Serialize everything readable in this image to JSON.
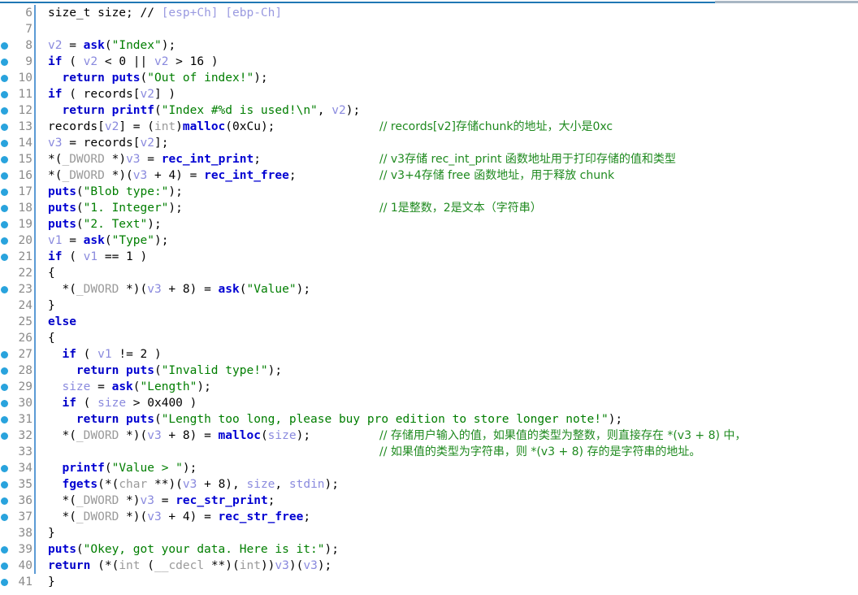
{
  "window": {
    "kind": "decompiler-pseudocode-view",
    "top_rule_color": "#1f77b4",
    "top_rule_secondary_color": "#a8b6c4"
  },
  "theme": {
    "background": "#ffffff",
    "keyword": "#0000c8",
    "function": "#0000d2",
    "string": "#007e00",
    "comment": "#1f8a1f",
    "variable": "#8a8ade",
    "type": "#9a9a9a",
    "linenumber": "#8b8b8b",
    "breakpoint_dot": "#29a3dd",
    "indent_bar": "#5b9bd5"
  },
  "code": {
    "first_line_number": 6,
    "last_line_number": 41,
    "lines": [
      {
        "n": "6",
        "dot": false,
        "bars": 1,
        "tokens": [
          {
            "t": "plain",
            "s": "size_t size; "
          },
          {
            "t": "plain",
            "s": "// "
          },
          {
            "t": "lavender",
            "s": "[esp+Ch] [ebp-Ch]"
          }
        ],
        "trailing": ""
      },
      {
        "n": "7",
        "dot": false,
        "bars": 1,
        "tokens": [],
        "trailing": ""
      },
      {
        "n": "8",
        "dot": true,
        "bars": 1,
        "tokens": [
          {
            "t": "var",
            "s": "v2"
          },
          {
            "t": "plain",
            "s": " = "
          },
          {
            "t": "fn",
            "s": "ask"
          },
          {
            "t": "plain",
            "s": "("
          },
          {
            "t": "str",
            "s": "\"Index\""
          },
          {
            "t": "plain",
            "s": ");"
          }
        ],
        "trailing": ""
      },
      {
        "n": "9",
        "dot": true,
        "bars": 1,
        "tokens": [
          {
            "t": "kw",
            "s": "if"
          },
          {
            "t": "plain",
            "s": " ( "
          },
          {
            "t": "var",
            "s": "v2"
          },
          {
            "t": "plain",
            "s": " < 0 || "
          },
          {
            "t": "var",
            "s": "v2"
          },
          {
            "t": "plain",
            "s": " > 16 )"
          }
        ],
        "trailing": ""
      },
      {
        "n": "10",
        "dot": true,
        "bars": 1,
        "tokens": [
          {
            "t": "plain",
            "s": "  "
          },
          {
            "t": "kw",
            "s": "return"
          },
          {
            "t": "plain",
            "s": " "
          },
          {
            "t": "fn",
            "s": "puts"
          },
          {
            "t": "plain",
            "s": "("
          },
          {
            "t": "str",
            "s": "\"Out of index!\""
          },
          {
            "t": "plain",
            "s": ");"
          }
        ],
        "trailing": ""
      },
      {
        "n": "11",
        "dot": true,
        "bars": 1,
        "tokens": [
          {
            "t": "kw",
            "s": "if"
          },
          {
            "t": "plain",
            "s": " ( records["
          },
          {
            "t": "var",
            "s": "v2"
          },
          {
            "t": "plain",
            "s": "] )"
          }
        ],
        "trailing": ""
      },
      {
        "n": "12",
        "dot": true,
        "bars": 1,
        "tokens": [
          {
            "t": "plain",
            "s": "  "
          },
          {
            "t": "kw",
            "s": "return"
          },
          {
            "t": "plain",
            "s": " "
          },
          {
            "t": "fn",
            "s": "printf"
          },
          {
            "t": "plain",
            "s": "("
          },
          {
            "t": "str",
            "s": "\"Index #%d is used!\\n\""
          },
          {
            "t": "plain",
            "s": ", "
          },
          {
            "t": "var",
            "s": "v2"
          },
          {
            "t": "plain",
            "s": ");"
          }
        ],
        "trailing": ""
      },
      {
        "n": "13",
        "dot": true,
        "bars": 1,
        "tokens": [
          {
            "t": "plain",
            "s": "records["
          },
          {
            "t": "var",
            "s": "v2"
          },
          {
            "t": "plain",
            "s": "] = ("
          },
          {
            "t": "typ",
            "s": "int"
          },
          {
            "t": "plain",
            "s": ")"
          },
          {
            "t": "fn",
            "s": "malloc"
          },
          {
            "t": "plain",
            "s": "(0xCu);"
          }
        ],
        "trailing": "// records[v2]存储chunk的地址，大小是0xc"
      },
      {
        "n": "14",
        "dot": true,
        "bars": 1,
        "tokens": [
          {
            "t": "var",
            "s": "v3"
          },
          {
            "t": "plain",
            "s": " = records["
          },
          {
            "t": "var",
            "s": "v2"
          },
          {
            "t": "plain",
            "s": "];"
          }
        ],
        "trailing": ""
      },
      {
        "n": "15",
        "dot": true,
        "bars": 1,
        "tokens": [
          {
            "t": "plain",
            "s": "*("
          },
          {
            "t": "typ",
            "s": "_DWORD"
          },
          {
            "t": "plain",
            "s": " *)"
          },
          {
            "t": "var",
            "s": "v3"
          },
          {
            "t": "plain",
            "s": " = "
          },
          {
            "t": "fn",
            "s": "rec_int_print"
          },
          {
            "t": "plain",
            "s": ";"
          }
        ],
        "trailing": "// v3存储 rec_int_print 函数地址用于打印存储的值和类型"
      },
      {
        "n": "16",
        "dot": true,
        "bars": 1,
        "tokens": [
          {
            "t": "plain",
            "s": "*("
          },
          {
            "t": "typ",
            "s": "_DWORD"
          },
          {
            "t": "plain",
            "s": " *)("
          },
          {
            "t": "var",
            "s": "v3"
          },
          {
            "t": "plain",
            "s": " + 4) = "
          },
          {
            "t": "fn",
            "s": "rec_int_free"
          },
          {
            "t": "plain",
            "s": ";"
          }
        ],
        "trailing": "// v3+4存储 free 函数地址，用于释放 chunk"
      },
      {
        "n": "17",
        "dot": true,
        "bars": 1,
        "tokens": [
          {
            "t": "fn",
            "s": "puts"
          },
          {
            "t": "plain",
            "s": "("
          },
          {
            "t": "str",
            "s": "\"Blob type:\""
          },
          {
            "t": "plain",
            "s": ");"
          }
        ],
        "trailing": ""
      },
      {
        "n": "18",
        "dot": true,
        "bars": 1,
        "tokens": [
          {
            "t": "fn",
            "s": "puts"
          },
          {
            "t": "plain",
            "s": "("
          },
          {
            "t": "str",
            "s": "\"1. Integer\""
          },
          {
            "t": "plain",
            "s": ");"
          }
        ],
        "trailing": "// 1是整数，2是文本（字符串）"
      },
      {
        "n": "19",
        "dot": true,
        "bars": 1,
        "tokens": [
          {
            "t": "fn",
            "s": "puts"
          },
          {
            "t": "plain",
            "s": "("
          },
          {
            "t": "str",
            "s": "\"2. Text\""
          },
          {
            "t": "plain",
            "s": ");"
          }
        ],
        "trailing": ""
      },
      {
        "n": "20",
        "dot": true,
        "bars": 1,
        "tokens": [
          {
            "t": "var",
            "s": "v1"
          },
          {
            "t": "plain",
            "s": " = "
          },
          {
            "t": "fn",
            "s": "ask"
          },
          {
            "t": "plain",
            "s": "("
          },
          {
            "t": "str",
            "s": "\"Type\""
          },
          {
            "t": "plain",
            "s": ");"
          }
        ],
        "trailing": ""
      },
      {
        "n": "21",
        "dot": true,
        "bars": 1,
        "tokens": [
          {
            "t": "kw",
            "s": "if"
          },
          {
            "t": "plain",
            "s": " ( "
          },
          {
            "t": "var",
            "s": "v1"
          },
          {
            "t": "plain",
            "s": " == 1 )"
          }
        ],
        "trailing": ""
      },
      {
        "n": "22",
        "dot": false,
        "bars": 1,
        "tokens": [
          {
            "t": "plain",
            "s": "{"
          }
        ],
        "trailing": ""
      },
      {
        "n": "23",
        "dot": true,
        "bars": 1,
        "tokens": [
          {
            "t": "plain",
            "s": "  *("
          },
          {
            "t": "typ",
            "s": "_DWORD"
          },
          {
            "t": "plain",
            "s": " *)("
          },
          {
            "t": "var",
            "s": "v3"
          },
          {
            "t": "plain",
            "s": " + 8) = "
          },
          {
            "t": "fn",
            "s": "ask"
          },
          {
            "t": "plain",
            "s": "("
          },
          {
            "t": "str",
            "s": "\"Value\""
          },
          {
            "t": "plain",
            "s": ");"
          }
        ],
        "trailing": ""
      },
      {
        "n": "24",
        "dot": false,
        "bars": 1,
        "tokens": [
          {
            "t": "plain",
            "s": "}"
          }
        ],
        "trailing": ""
      },
      {
        "n": "25",
        "dot": false,
        "bars": 1,
        "tokens": [
          {
            "t": "kw",
            "s": "else"
          }
        ],
        "trailing": ""
      },
      {
        "n": "26",
        "dot": false,
        "bars": 1,
        "tokens": [
          {
            "t": "plain",
            "s": "{"
          }
        ],
        "trailing": ""
      },
      {
        "n": "27",
        "dot": true,
        "bars": 1,
        "tokens": [
          {
            "t": "plain",
            "s": "  "
          },
          {
            "t": "kw",
            "s": "if"
          },
          {
            "t": "plain",
            "s": " ( "
          },
          {
            "t": "var",
            "s": "v1"
          },
          {
            "t": "plain",
            "s": " != 2 )"
          }
        ],
        "trailing": ""
      },
      {
        "n": "28",
        "dot": true,
        "bars": 1,
        "tokens": [
          {
            "t": "plain",
            "s": "    "
          },
          {
            "t": "kw",
            "s": "return"
          },
          {
            "t": "plain",
            "s": " "
          },
          {
            "t": "fn",
            "s": "puts"
          },
          {
            "t": "plain",
            "s": "("
          },
          {
            "t": "str",
            "s": "\"Invalid type!\""
          },
          {
            "t": "plain",
            "s": ");"
          }
        ],
        "trailing": ""
      },
      {
        "n": "29",
        "dot": true,
        "bars": 1,
        "tokens": [
          {
            "t": "plain",
            "s": "  "
          },
          {
            "t": "var",
            "s": "size"
          },
          {
            "t": "plain",
            "s": " = "
          },
          {
            "t": "fn",
            "s": "ask"
          },
          {
            "t": "plain",
            "s": "("
          },
          {
            "t": "str",
            "s": "\"Length\""
          },
          {
            "t": "plain",
            "s": ");"
          }
        ],
        "trailing": ""
      },
      {
        "n": "30",
        "dot": true,
        "bars": 1,
        "tokens": [
          {
            "t": "plain",
            "s": "  "
          },
          {
            "t": "kw",
            "s": "if"
          },
          {
            "t": "plain",
            "s": " ( "
          },
          {
            "t": "var",
            "s": "size"
          },
          {
            "t": "plain",
            "s": " > 0x400 )"
          }
        ],
        "trailing": ""
      },
      {
        "n": "31",
        "dot": true,
        "bars": 1,
        "tokens": [
          {
            "t": "plain",
            "s": "    "
          },
          {
            "t": "kw",
            "s": "return"
          },
          {
            "t": "plain",
            "s": " "
          },
          {
            "t": "fn",
            "s": "puts"
          },
          {
            "t": "plain",
            "s": "("
          },
          {
            "t": "str",
            "s": "\"Length too long, please buy pro edition to store longer note!\""
          },
          {
            "t": "plain",
            "s": ");"
          }
        ],
        "trailing": ""
      },
      {
        "n": "32",
        "dot": true,
        "bars": 1,
        "tokens": [
          {
            "t": "plain",
            "s": "  *("
          },
          {
            "t": "typ",
            "s": "_DWORD"
          },
          {
            "t": "plain",
            "s": " *)("
          },
          {
            "t": "var",
            "s": "v3"
          },
          {
            "t": "plain",
            "s": " + 8) = "
          },
          {
            "t": "fn",
            "s": "malloc"
          },
          {
            "t": "plain",
            "s": "("
          },
          {
            "t": "var",
            "s": "size"
          },
          {
            "t": "plain",
            "s": ");"
          }
        ],
        "trailing": "// 存储用户输入的值，如果值的类型为整数，则直接存在 *(v3 + 8) 中，"
      },
      {
        "n": "33",
        "dot": false,
        "bars": 1,
        "tokens": [],
        "trailing": "// 如果值的类型为字符串，则 *(v3 + 8) 存的是字符串的地址。"
      },
      {
        "n": "34",
        "dot": true,
        "bars": 1,
        "tokens": [
          {
            "t": "plain",
            "s": "  "
          },
          {
            "t": "fn",
            "s": "printf"
          },
          {
            "t": "plain",
            "s": "("
          },
          {
            "t": "str",
            "s": "\"Value > \""
          },
          {
            "t": "plain",
            "s": ");"
          }
        ],
        "trailing": ""
      },
      {
        "n": "35",
        "dot": true,
        "bars": 1,
        "tokens": [
          {
            "t": "plain",
            "s": "  "
          },
          {
            "t": "fn",
            "s": "fgets"
          },
          {
            "t": "plain",
            "s": "(*("
          },
          {
            "t": "typ",
            "s": "char"
          },
          {
            "t": "plain",
            "s": " **)("
          },
          {
            "t": "var",
            "s": "v3"
          },
          {
            "t": "plain",
            "s": " + 8), "
          },
          {
            "t": "var",
            "s": "size"
          },
          {
            "t": "plain",
            "s": ", "
          },
          {
            "t": "var",
            "s": "stdin"
          },
          {
            "t": "plain",
            "s": ");"
          }
        ],
        "trailing": ""
      },
      {
        "n": "36",
        "dot": true,
        "bars": 1,
        "tokens": [
          {
            "t": "plain",
            "s": "  *("
          },
          {
            "t": "typ",
            "s": "_DWORD"
          },
          {
            "t": "plain",
            "s": " *)"
          },
          {
            "t": "var",
            "s": "v3"
          },
          {
            "t": "plain",
            "s": " = "
          },
          {
            "t": "fn",
            "s": "rec_str_print"
          },
          {
            "t": "plain",
            "s": ";"
          }
        ],
        "trailing": ""
      },
      {
        "n": "37",
        "dot": true,
        "bars": 1,
        "tokens": [
          {
            "t": "plain",
            "s": "  *("
          },
          {
            "t": "typ",
            "s": "_DWORD"
          },
          {
            "t": "plain",
            "s": " *)("
          },
          {
            "t": "var",
            "s": "v3"
          },
          {
            "t": "plain",
            "s": " + 4) = "
          },
          {
            "t": "fn",
            "s": "rec_str_free"
          },
          {
            "t": "plain",
            "s": ";"
          }
        ],
        "trailing": ""
      },
      {
        "n": "38",
        "dot": false,
        "bars": 1,
        "tokens": [
          {
            "t": "plain",
            "s": "}"
          }
        ],
        "trailing": ""
      },
      {
        "n": "39",
        "dot": true,
        "bars": 1,
        "tokens": [
          {
            "t": "fn",
            "s": "puts"
          },
          {
            "t": "plain",
            "s": "("
          },
          {
            "t": "str",
            "s": "\"Okey, got your data. Here is it:\""
          },
          {
            "t": "plain",
            "s": ");"
          }
        ],
        "trailing": ""
      },
      {
        "n": "40",
        "dot": true,
        "bars": 1,
        "tokens": [
          {
            "t": "kw",
            "s": "return"
          },
          {
            "t": "plain",
            "s": " (*("
          },
          {
            "t": "typ",
            "s": "int"
          },
          {
            "t": "plain",
            "s": " ("
          },
          {
            "t": "typ",
            "s": "__cdecl"
          },
          {
            "t": "plain",
            "s": " **)("
          },
          {
            "t": "typ",
            "s": "int"
          },
          {
            "t": "plain",
            "s": "))"
          },
          {
            "t": "var",
            "s": "v3"
          },
          {
            "t": "plain",
            "s": ")("
          },
          {
            "t": "var",
            "s": "v3"
          },
          {
            "t": "plain",
            "s": ");"
          }
        ],
        "trailing": ""
      },
      {
        "n": "41",
        "dot": true,
        "bars": 0,
        "tokens": [
          {
            "t": "plain",
            "s": "}"
          }
        ],
        "trailing": ""
      }
    ]
  }
}
